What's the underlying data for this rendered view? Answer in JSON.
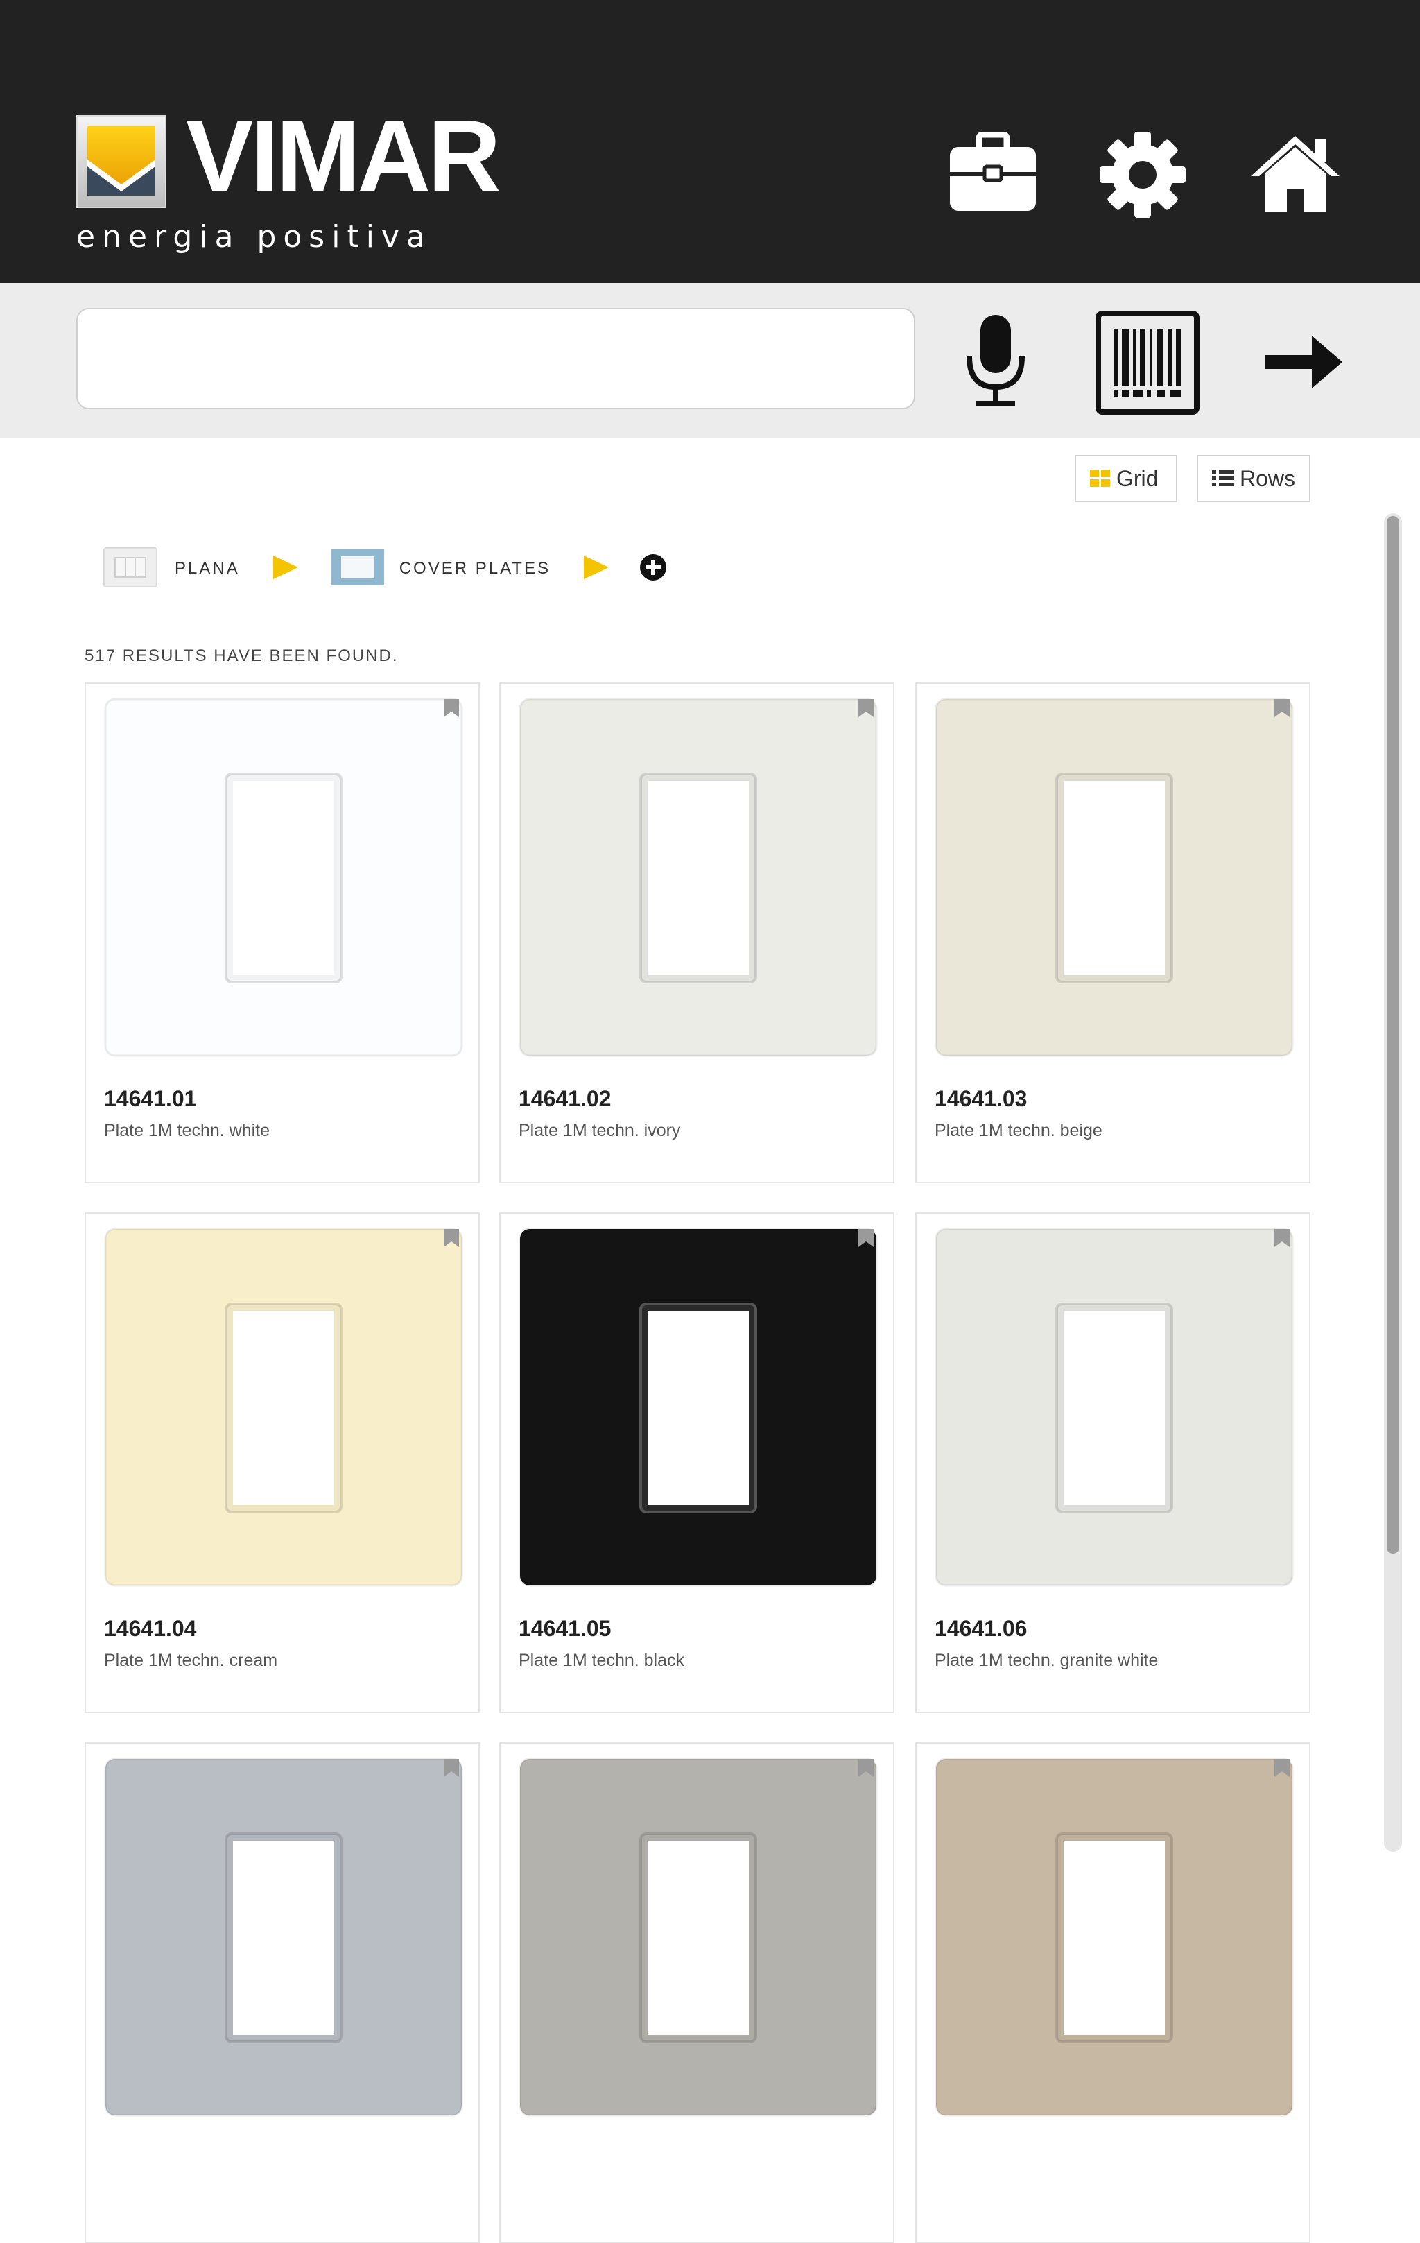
{
  "header": {
    "brand": "VIMAR",
    "tagline": "energia positiva",
    "icons": [
      "briefcase-icon",
      "gear-icon",
      "home-icon"
    ]
  },
  "search": {
    "value": "",
    "placeholder": "",
    "icons": [
      "microphone-icon",
      "barcode-icon",
      "arrow-right-icon"
    ]
  },
  "view": {
    "grid_label": "Grid",
    "rows_label": "Rows"
  },
  "breadcrumb": {
    "items": [
      {
        "label": "PLANA"
      },
      {
        "label": "COVER PLATES"
      }
    ]
  },
  "results_text": "517 RESULTS HAVE BEEN FOUND.",
  "products": [
    {
      "code": "14641.01",
      "name": "Plate 1M techn. white",
      "color": "#fbfdfe"
    },
    {
      "code": "14641.02",
      "name": "Plate 1M techn. ivory",
      "color": "#ecece7"
    },
    {
      "code": "14641.03",
      "name": "Plate 1M techn. beige",
      "color": "#eae7d9"
    },
    {
      "code": "14641.04",
      "name": "Plate 1M techn. cream",
      "color": "#f8efca"
    },
    {
      "code": "14641.05",
      "name": "Plate 1M techn. black",
      "color": "#141414"
    },
    {
      "code": "14641.06",
      "name": "Plate 1M techn. granite white",
      "color": "#e8e8e3"
    },
    {
      "code": "",
      "name": "",
      "color": "#b9bec4"
    },
    {
      "code": "",
      "name": "",
      "color": "#b3b2ac"
    },
    {
      "code": "",
      "name": "",
      "color": "#c7b8a3"
    }
  ],
  "colors": {
    "header_bg": "#222222",
    "accent_yellow": "#f5c400",
    "search_bg": "#ececec"
  }
}
